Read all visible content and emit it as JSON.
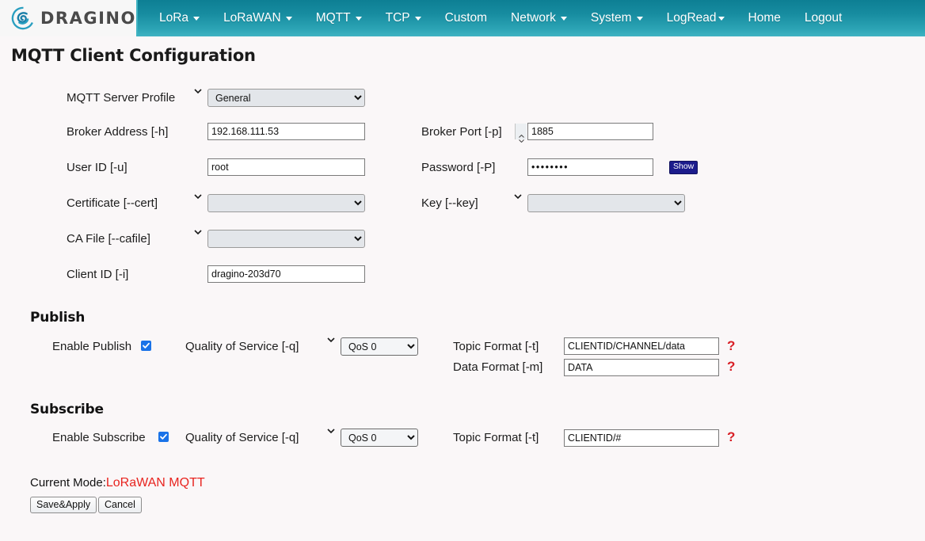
{
  "brand": {
    "name": "DRAGINO",
    "logo_icon": "dragino-swirl-logo",
    "accent_color": "#178ca0"
  },
  "nav": {
    "items": [
      {
        "label": "LoRa",
        "has_caret": true
      },
      {
        "label": "LoRaWAN",
        "has_caret": true
      },
      {
        "label": "MQTT",
        "has_caret": true
      },
      {
        "label": "TCP",
        "has_caret": true
      },
      {
        "label": "Custom",
        "has_caret": false
      },
      {
        "label": "Network",
        "has_caret": true
      },
      {
        "label": "System",
        "has_caret": true
      },
      {
        "label": "LogRead",
        "has_caret": true,
        "tight": true
      },
      {
        "label": "Home",
        "has_caret": false
      },
      {
        "label": "Logout",
        "has_caret": false
      }
    ]
  },
  "page": {
    "title": "MQTT Client Configuration"
  },
  "form": {
    "server_profile": {
      "label": "MQTT Server Profile",
      "value": "General"
    },
    "broker_address": {
      "label": "Broker Address [-h]",
      "value": "192.168.111.53"
    },
    "broker_port": {
      "label": "Broker Port [-p]",
      "value": "1885"
    },
    "user_id": {
      "label": "User ID [-u]",
      "value": "root"
    },
    "password": {
      "label": "Password [-P]",
      "value": "••••••••",
      "show_label": "Show"
    },
    "certificate": {
      "label": "Certificate [--cert]",
      "value": ""
    },
    "key": {
      "label": "Key [--key]",
      "value": ""
    },
    "ca_file": {
      "label": "CA File [--cafile]",
      "value": ""
    },
    "client_id": {
      "label": "Client ID [-i]",
      "value": "dragino-203d70"
    }
  },
  "publish": {
    "heading": "Publish",
    "enable_label": "Enable Publish",
    "enabled": true,
    "qos_label": "Quality of Service [-q]",
    "qos_value": "QoS 0",
    "topic_format_label": "Topic Format [-t]",
    "topic_format_value": "CLIENTID/CHANNEL/data",
    "data_format_label": "Data Format [-m]",
    "data_format_value": "DATA",
    "help_marker": "?"
  },
  "subscribe": {
    "heading": "Subscribe",
    "enable_label": "Enable Subscribe",
    "enabled": true,
    "qos_label": "Quality of Service [-q]",
    "qos_value": "QoS 0",
    "topic_format_label": "Topic Format [-t]",
    "topic_format_value": "CLIENTID/#",
    "help_marker": "?"
  },
  "footer": {
    "current_mode_label": "Current Mode:",
    "current_mode_value": "LoRaWAN MQTT",
    "save_label": "Save&Apply",
    "cancel_label": "Cancel"
  }
}
